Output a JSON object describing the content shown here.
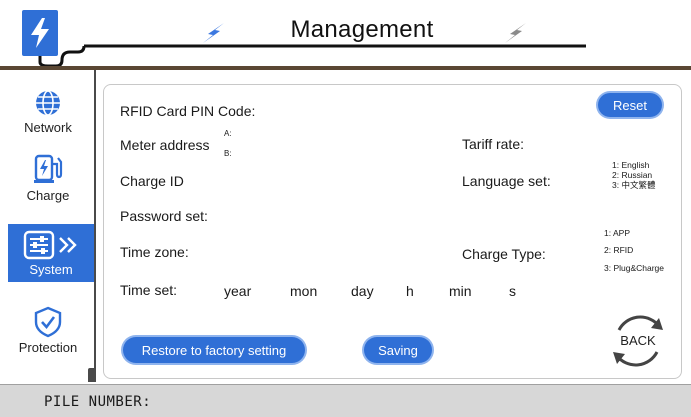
{
  "header": {
    "title": "Management",
    "logo_icon": "ev-charger-plug-icon",
    "accent_color": "#2f6fd6"
  },
  "sidebar": {
    "items": [
      {
        "label": "Network",
        "icon": "globe-icon"
      },
      {
        "label": "Charge",
        "icon": "charging-station-icon"
      },
      {
        "label": "System",
        "icon": "sliders-icon",
        "active": true
      },
      {
        "label": "Protection",
        "icon": "shield-check-icon"
      }
    ]
  },
  "panel": {
    "rfid_pin": "RFID Card PIN Code:",
    "meter_address": "Meter address",
    "meter_a": "A:",
    "meter_b": "B:",
    "tariff_rate": "Tariff rate:",
    "charge_id": "Charge ID",
    "language_set": "Language set:",
    "language_options": [
      "1: English",
      "2: Russian",
      "3: 中文繁體"
    ],
    "password_set": "Password set:",
    "time_zone": "Time zone:",
    "charge_type": "Charge Type:",
    "charge_type_options": [
      "1: APP",
      "2: RFID",
      "3: Plug&Charge"
    ],
    "time_set": "Time set:",
    "time_units": [
      "year",
      "mon",
      "day",
      "h",
      "min",
      "s"
    ],
    "reset_label": "Reset",
    "restore_label": "Restore to factory setting",
    "saving_label": "Saving",
    "back_label": "BACK"
  },
  "footer": {
    "pile_number": "PILE NUMBER:"
  }
}
